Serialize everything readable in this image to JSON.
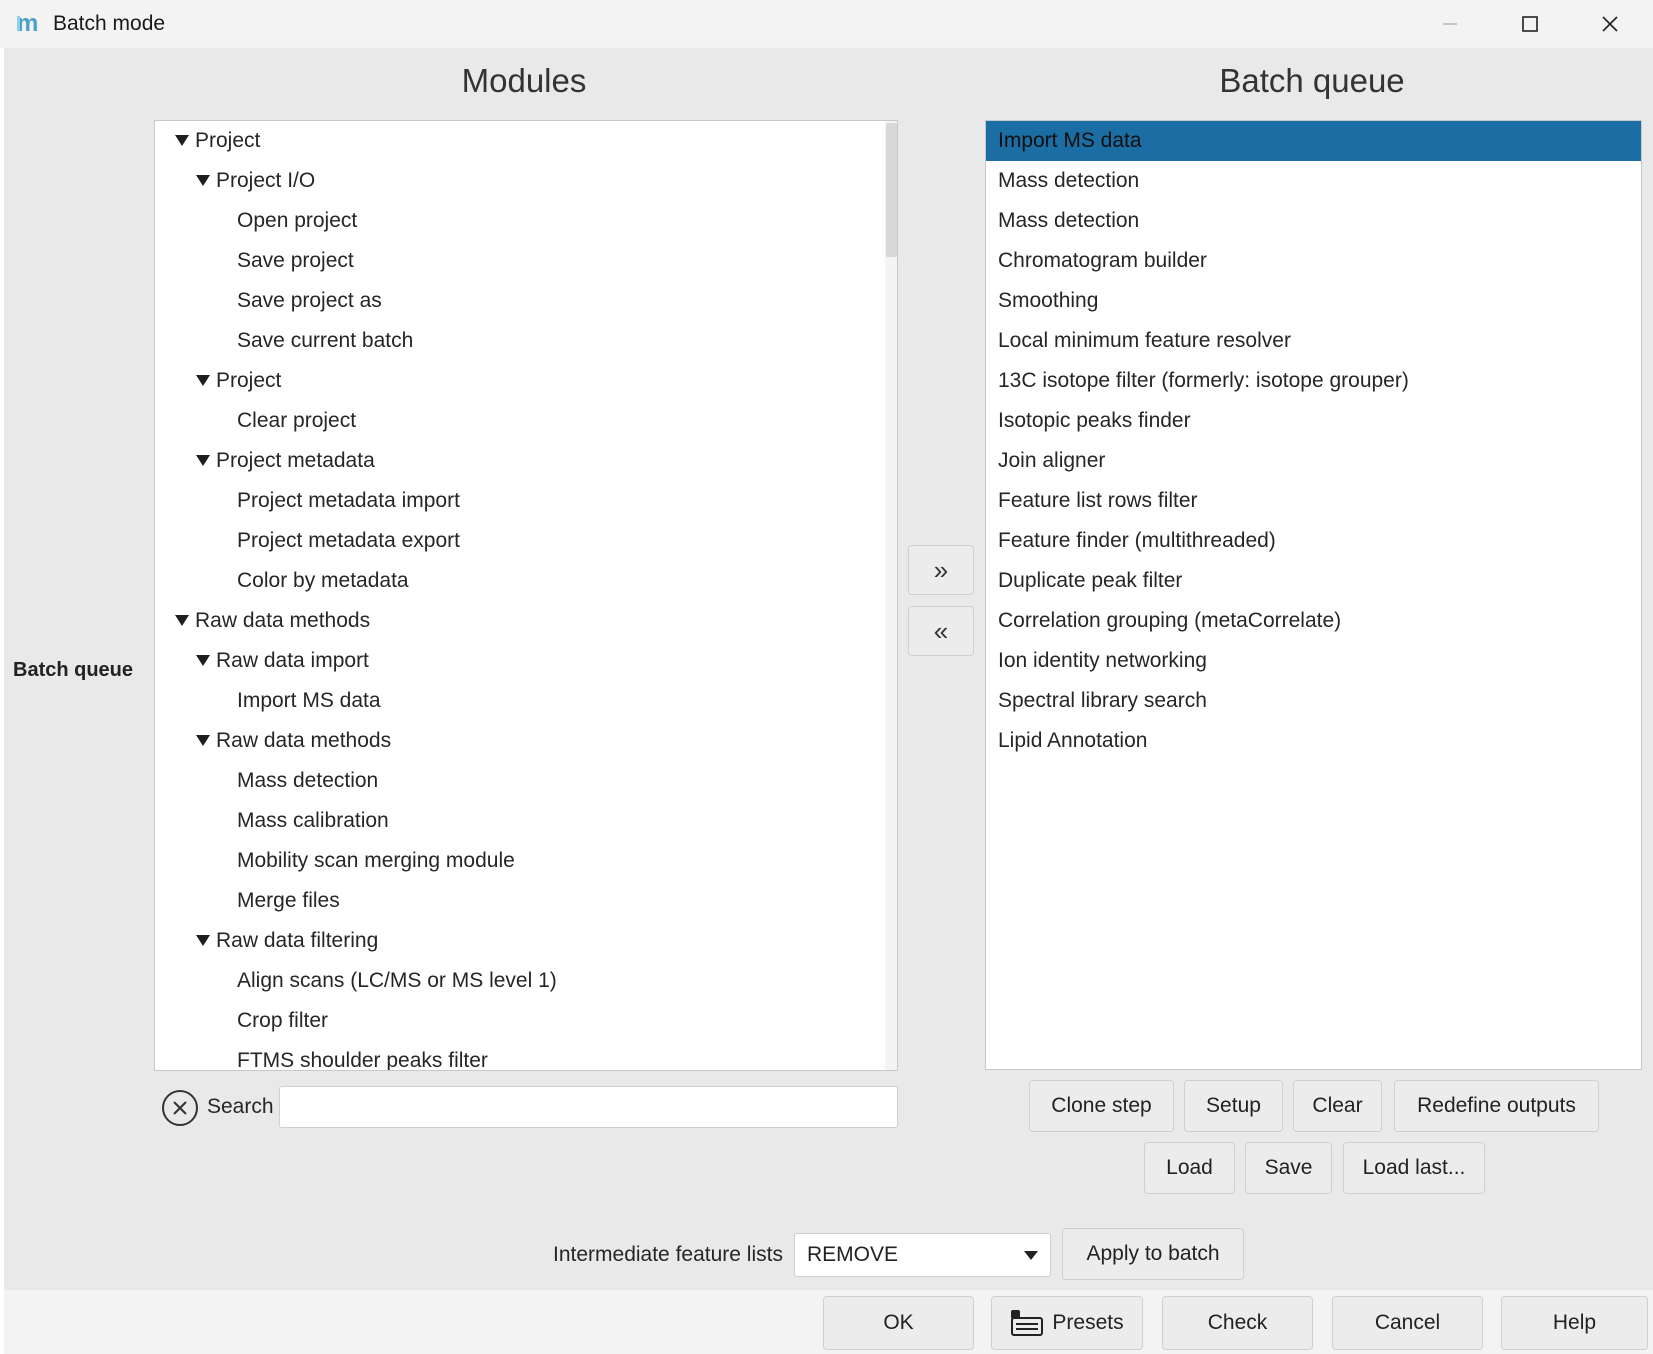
{
  "window": {
    "title": "Batch mode",
    "icon": "mzmine-logo-icon",
    "controls": [
      "minimize-icon",
      "maximize-icon",
      "close-icon"
    ]
  },
  "modules_heading": "Modules",
  "queue_heading": "Batch queue",
  "side_label": "Batch queue",
  "module_tree": [
    {
      "label": "Project",
      "level": 0,
      "expanded": true
    },
    {
      "label": "Project I/O",
      "level": 1,
      "expanded": true
    },
    {
      "label": "Open project",
      "level": 2
    },
    {
      "label": "Save project",
      "level": 2
    },
    {
      "label": "Save project as",
      "level": 2
    },
    {
      "label": "Save current batch",
      "level": 2
    },
    {
      "label": "Project",
      "level": 1,
      "expanded": true
    },
    {
      "label": "Clear project",
      "level": 2
    },
    {
      "label": "Project metadata",
      "level": 1,
      "expanded": true
    },
    {
      "label": "Project metadata import",
      "level": 2
    },
    {
      "label": "Project metadata export",
      "level": 2
    },
    {
      "label": "Color by metadata",
      "level": 2
    },
    {
      "label": "Raw data methods",
      "level": 0,
      "expanded": true
    },
    {
      "label": "Raw data import",
      "level": 1,
      "expanded": true
    },
    {
      "label": "Import MS data",
      "level": 2
    },
    {
      "label": "Raw data methods",
      "level": 1,
      "expanded": true
    },
    {
      "label": "Mass detection",
      "level": 2
    },
    {
      "label": "Mass calibration",
      "level": 2
    },
    {
      "label": "Mobility scan merging module",
      "level": 2
    },
    {
      "label": "Merge files",
      "level": 2
    },
    {
      "label": "Raw data filtering",
      "level": 1,
      "expanded": true
    },
    {
      "label": "Align scans (LC/MS or MS level 1)",
      "level": 2
    },
    {
      "label": "Crop filter",
      "level": 2
    },
    {
      "label": "FTMS shoulder peaks filter",
      "level": 2
    }
  ],
  "move_buttons": {
    "add": "»",
    "remove": "«"
  },
  "batch_queue": [
    "Import MS data",
    "Mass detection",
    "Mass detection",
    "Chromatogram builder",
    "Smoothing",
    "Local minimum feature resolver",
    "13C isotope filter (formerly: isotope grouper)",
    "Isotopic peaks finder",
    "Join aligner",
    "Feature list rows filter",
    "Feature finder (multithreaded)",
    "Duplicate peak filter",
    "Correlation grouping (metaCorrelate)",
    "Ion identity networking",
    "Spectral library search",
    "Lipid Annotation"
  ],
  "selected_queue_index": 0,
  "search": {
    "label": "Search",
    "value": "",
    "clear_icon": "clear-circle-icon"
  },
  "queue_buttons": {
    "clone": "Clone step",
    "setup": "Setup",
    "clear": "Clear",
    "redefine": "Redefine outputs",
    "load": "Load",
    "save": "Save",
    "load_last": "Load last..."
  },
  "intermediate": {
    "label": "Intermediate feature lists",
    "value": "REMOVE",
    "apply": "Apply to batch"
  },
  "footer_buttons": {
    "ok": "OK",
    "presets": "Presets",
    "presets_icon": "presets-icon",
    "check": "Check",
    "cancel": "Cancel",
    "help": "Help"
  },
  "colors": {
    "selection": "#1b6ea3",
    "dialog_bg": "#e9e9e9",
    "titlebar_bg": "#f3f3f3"
  }
}
